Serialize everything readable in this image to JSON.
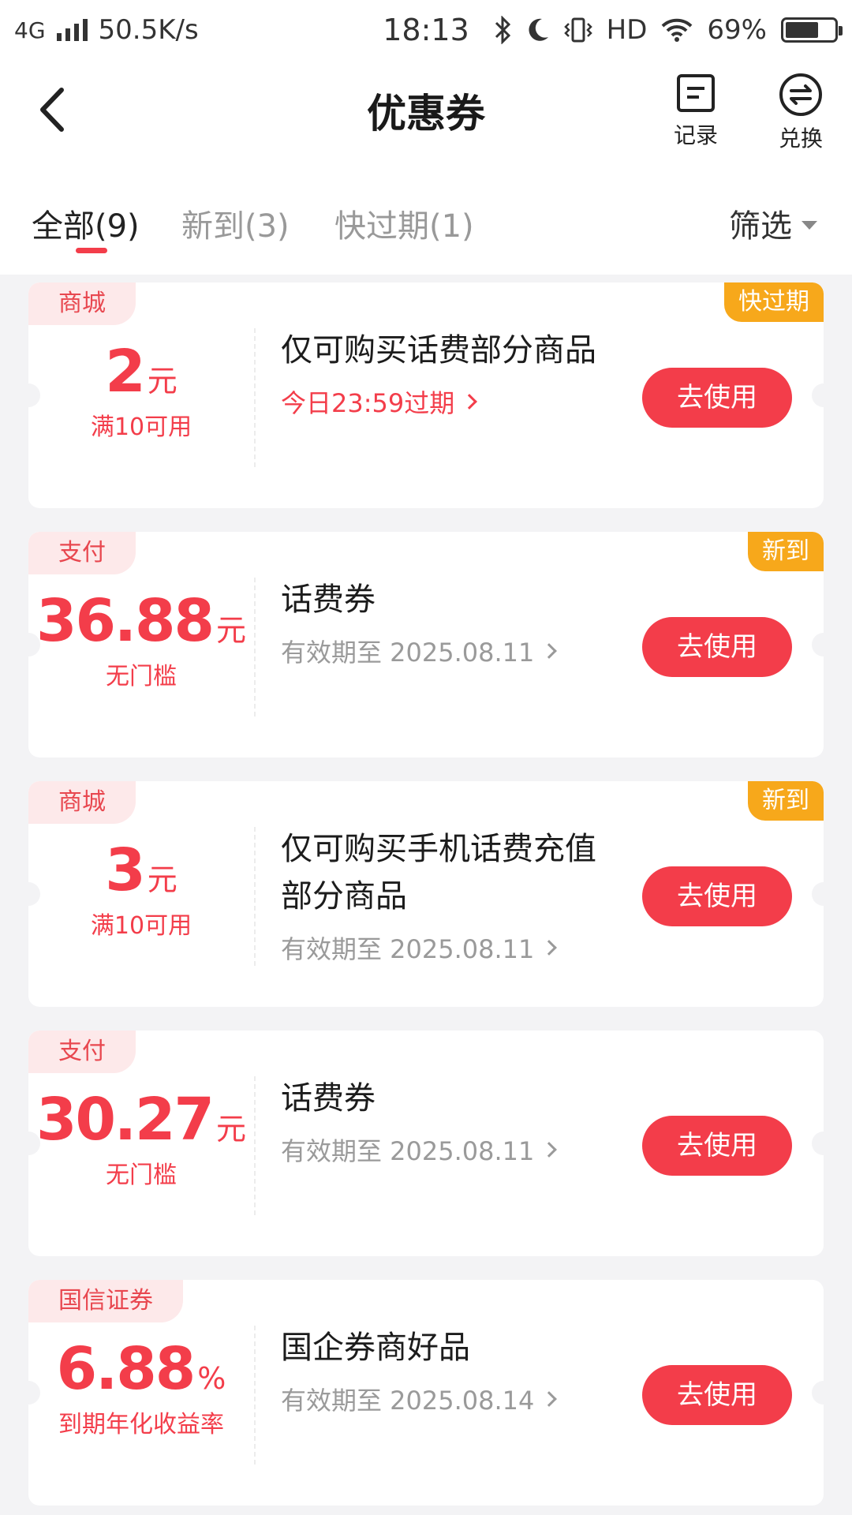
{
  "status_bar": {
    "network": "4G",
    "speed": "50.5K/s",
    "time": "18:13",
    "hd": "HD",
    "battery_percent": "69%",
    "battery_level": 0.69
  },
  "header": {
    "title": "优惠券",
    "record_label": "记录",
    "exchange_label": "兑换"
  },
  "tabs": [
    {
      "label": "全部(9)",
      "active": true
    },
    {
      "label": "新到(3)",
      "active": false
    },
    {
      "label": "快过期(1)",
      "active": false
    }
  ],
  "filter_label": "筛选",
  "coupons": [
    {
      "category": "商城",
      "status": "快过期",
      "amount": "2",
      "unit": "元",
      "condition": "满10可用",
      "title": "仅可购买话费部分商品",
      "validity": "今日23:59过期",
      "urgent": true,
      "button": "去使用"
    },
    {
      "category": "支付",
      "status": "新到",
      "amount": "36.88",
      "unit": "元",
      "condition": "无门槛",
      "title": "话费券",
      "validity": "有效期至 2025.08.11",
      "urgent": false,
      "button": "去使用"
    },
    {
      "category": "商城",
      "status": "新到",
      "amount": "3",
      "unit": "元",
      "condition": "满10可用",
      "title": "仅可购买手机话费充值部分商品",
      "validity": "有效期至 2025.08.11",
      "urgent": false,
      "button": "去使用"
    },
    {
      "category": "支付",
      "status": "",
      "amount": "30.27",
      "unit": "元",
      "condition": "无门槛",
      "title": "话费券",
      "validity": "有效期至 2025.08.11",
      "urgent": false,
      "button": "去使用"
    },
    {
      "category": "国信证券",
      "status": "",
      "amount": "6.88",
      "unit": "%",
      "condition": "到期年化收益率",
      "title": "国企券商好品",
      "validity": "有效期至 2025.08.14",
      "urgent": false,
      "button": "去使用"
    }
  ],
  "colors": {
    "accent": "#f33d4a",
    "tag_bg": "#fde9ea",
    "status_tag": "#f7a81b",
    "page_bg": "#f3f3f5"
  }
}
